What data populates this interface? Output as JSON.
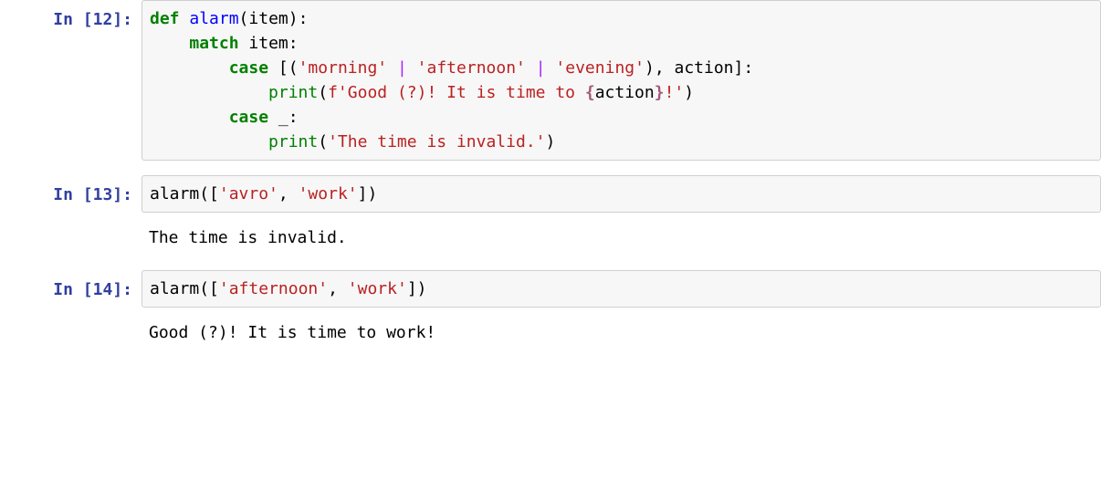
{
  "cells": [
    {
      "prompt_prefix": "In [",
      "number": "12",
      "prompt_suffix": "]:",
      "code": {
        "kw_def": "def",
        "fn_name": "alarm",
        "paren_open": "(",
        "param": "item",
        "paren_close": ")",
        "colon": ":",
        "indent1": "    ",
        "kw_match": "match",
        "space": " ",
        "match_subject": "item",
        "indent2": "        ",
        "kw_case": "case",
        "lbracket": "[",
        "lparen": "(",
        "str_morning": "'morning'",
        "pipe": "|",
        "str_afternoon": "'afternoon'",
        "str_evening": "'evening'",
        "rparen": ")",
        "comma": ",",
        "action_id": "action",
        "rbracket": "]",
        "indent3": "            ",
        "builtin_print": "print",
        "fprefix": "f",
        "fstr_open": "'",
        "fstr_part1": "Good (?)! It is time to ",
        "lbrace": "{",
        "interp_name": "action",
        "rbrace": "}",
        "fstr_part2": "!",
        "fstr_close": "'",
        "underscore": "_",
        "str_invalid": "'The time is invalid.'"
      }
    },
    {
      "prompt_prefix": "In [",
      "number": "13",
      "prompt_suffix": "]:",
      "call": {
        "fn": "alarm",
        "arg_open": "([",
        "s1": "'avro'",
        "comma": ",",
        "s2": "'work'",
        "arg_close": "])"
      },
      "output": "The time is invalid."
    },
    {
      "prompt_prefix": "In [",
      "number": "14",
      "prompt_suffix": "]:",
      "call": {
        "fn": "alarm",
        "arg_open": "([",
        "s1": "'afternoon'",
        "comma": ",",
        "s2": "'work'",
        "arg_close": "])"
      },
      "output": "Good (?)! It is time to work!"
    }
  ]
}
